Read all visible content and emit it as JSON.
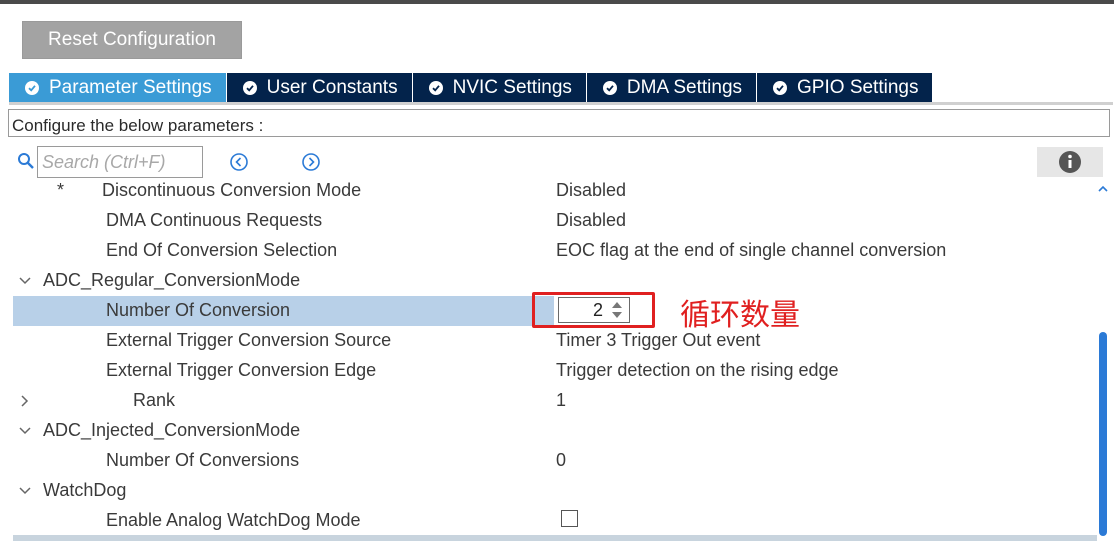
{
  "toolbar": {
    "reset_label": "Reset Configuration"
  },
  "tabs": [
    {
      "label": "Parameter Settings",
      "active": true
    },
    {
      "label": "User Constants",
      "active": false
    },
    {
      "label": "NVIC Settings",
      "active": false
    },
    {
      "label": "DMA Settings",
      "active": false
    },
    {
      "label": "GPIO Settings",
      "active": false
    }
  ],
  "description": "Configure the below parameters :",
  "search": {
    "placeholder": "Search (Ctrl+F)",
    "value": ""
  },
  "params": {
    "discontinuous": {
      "label": "Discontinuous Conversion Mode",
      "marker": "*",
      "value": "Disabled"
    },
    "dma_continuous": {
      "label": "DMA Continuous Requests",
      "value": "Disabled"
    },
    "eoc": {
      "label": "End Of Conversion Selection",
      "value": "EOC flag at the end of single channel conversion"
    },
    "regular_group": {
      "label": "ADC_Regular_ConversionMode",
      "expanded": true
    },
    "num_conversion": {
      "label": "Number Of Conversion",
      "value": "2"
    },
    "ext_trigger_source": {
      "label": "External Trigger Conversion Source",
      "value": "Timer 3 Trigger Out event"
    },
    "ext_trigger_edge": {
      "label": "External Trigger Conversion Edge",
      "value": "Trigger detection on the rising edge"
    },
    "rank": {
      "label": "Rank",
      "value": "1",
      "expanded": false
    },
    "injected_group": {
      "label": "ADC_Injected_ConversionMode",
      "expanded": true
    },
    "num_conversions_injected": {
      "label": "Number Of Conversions",
      "value": "0"
    },
    "watchdog_group": {
      "label": "WatchDog",
      "expanded": true
    },
    "analog_watchdog": {
      "label": "Enable Analog WatchDog Mode",
      "checked": false
    }
  },
  "annotation": {
    "text": "循环数量",
    "color": "#e02020"
  },
  "colors": {
    "tab_active": "#3a9bd6",
    "tab_inactive": "#03234b",
    "selected_row": "#b8d0e8",
    "scrollbar": "#2b7ad6"
  },
  "icons": {
    "search": "search-icon",
    "prev": "arrow-left-circle-icon",
    "next": "arrow-right-circle-icon",
    "info": "info-icon",
    "tab_check": "check-circle-icon"
  }
}
